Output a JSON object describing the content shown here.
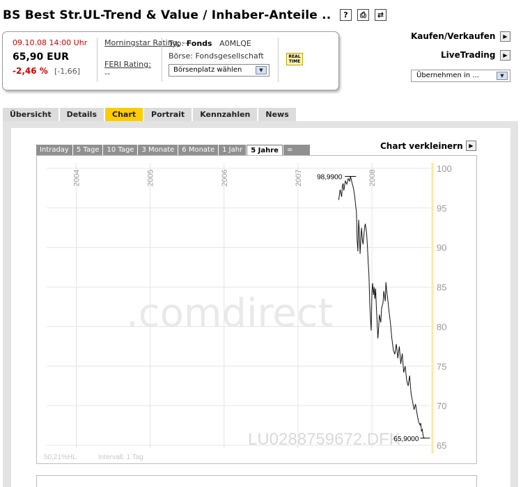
{
  "header": {
    "title": "BS Best Str.UL-Trend & Value / Inhaber-Anteile ..",
    "icons": [
      "help-icon",
      "print-icon",
      "share-icon"
    ]
  },
  "quote": {
    "datetime": "09.10.08 14:00 Uhr",
    "price": "65,90 EUR",
    "change_pct": "-2,46 %",
    "change_abs": "[-1,66]",
    "morningstar_label": "Morningstar Rating:",
    "morningstar_value": "--",
    "feri_label": "FERI Rating:",
    "feri_value": "--",
    "typ_label": "Typ:",
    "typ_value": "Fonds",
    "wkn": "A0MLQE",
    "boerse": "Börse: Fondsgesellschaft",
    "boersenplatz_select": "Börsenplatz wählen",
    "realtime_badge": "REAL TIME"
  },
  "side": {
    "kaufen": "Kaufen/Verkaufen",
    "livetrading": "LiveTrading",
    "uebernehmen": "Übernehmen in ..."
  },
  "tabs": [
    {
      "label": "Übersicht",
      "active": false
    },
    {
      "label": "Details",
      "active": false
    },
    {
      "label": "Chart",
      "active": true
    },
    {
      "label": "Portrait",
      "active": false
    },
    {
      "label": "Kennzahlen",
      "active": false
    },
    {
      "label": "News",
      "active": false
    }
  ],
  "periods": [
    {
      "label": "Intraday",
      "active": false
    },
    {
      "label": "5 Tage",
      "active": false
    },
    {
      "label": "10 Tage",
      "active": false
    },
    {
      "label": "3 Monate",
      "active": false
    },
    {
      "label": "6 Monate",
      "active": false
    },
    {
      "label": "1 Jahr",
      "active": false
    },
    {
      "label": "5 Jahre",
      "active": true
    },
    {
      "label": "∞",
      "active": false
    }
  ],
  "chart_toggle": "Chart verkleinern",
  "colors": {
    "accent": "#ffcc00",
    "negative": "#cc0000",
    "tab_bg": "#dcdcdc",
    "period_bg": "#909090",
    "watermark": "#e9e9e9",
    "marker": "#ffe7a0"
  },
  "chart_data": {
    "type": "line",
    "x_ticks": [
      "2004",
      "2005",
      "2006",
      "2007",
      "2008"
    ],
    "y_ticks": [
      100,
      95,
      90,
      85,
      80,
      75,
      70,
      65
    ],
    "ylim": [
      65,
      100
    ],
    "xlim": [
      2003.6,
      2008.8
    ],
    "max_label": "98,9900",
    "last_label": "65,9000",
    "watermark": ".comdirect",
    "isin_label": "LU0288759672.DFK",
    "footer_left": "50,21%HL",
    "footer_interval": "Intervall: 1 Tag",
    "series": [
      {
        "x": [
          2007.55,
          2007.57,
          2007.59,
          2007.6,
          2007.61,
          2007.62,
          2007.64,
          2007.66,
          2007.68,
          2007.7,
          2007.71,
          2007.72,
          2007.73,
          2007.75,
          2007.77,
          2007.78,
          2007.79,
          2007.8,
          2007.81,
          2007.82,
          2007.83,
          2007.84,
          2007.85,
          2007.86,
          2007.87,
          2007.88,
          2007.9,
          2007.91,
          2007.92,
          2007.93,
          2007.94,
          2007.95,
          2007.96,
          2007.97,
          2007.98,
          2007.99,
          2008.0,
          2008.01,
          2008.02,
          2008.03,
          2008.04,
          2008.05,
          2008.06,
          2008.07,
          2008.08,
          2008.09,
          2008.1,
          2008.12,
          2008.13,
          2008.15,
          2008.16,
          2008.18,
          2008.19,
          2008.2,
          2008.22,
          2008.23,
          2008.25,
          2008.27,
          2008.29,
          2008.31,
          2008.33,
          2008.35,
          2008.37,
          2008.39,
          2008.41,
          2008.43,
          2008.45,
          2008.47,
          2008.49,
          2008.51,
          2008.53,
          2008.55,
          2008.57,
          2008.59,
          2008.61,
          2008.63,
          2008.65,
          2008.66,
          2008.67,
          2008.68,
          2008.69,
          2008.7,
          2008.71
        ],
        "y": [
          96.0,
          97.3,
          96.4,
          97.8,
          98.1,
          97.2,
          98.4,
          98.0,
          98.7,
          98.4,
          98.99,
          98.6,
          98.2,
          97.5,
          96.2,
          95.3,
          94.5,
          91.0,
          89.5,
          93.5,
          92.0,
          89.2,
          91.2,
          92.5,
          91.0,
          90.4,
          92.5,
          93.0,
          92.4,
          91.6,
          90.0,
          88.0,
          86.5,
          83.0,
          81.0,
          79.5,
          84.5,
          85.5,
          84.0,
          85.0,
          83.5,
          84.8,
          82.5,
          80.6,
          78.5,
          79.7,
          81.5,
          80.5,
          82.3,
          83.0,
          84.5,
          83.2,
          85.6,
          84.5,
          83.0,
          82.0,
          80.5,
          78.5,
          77.0,
          76.5,
          77.8,
          76.0,
          77.5,
          75.3,
          76.6,
          74.2,
          75.0,
          73.2,
          72.5,
          73.8,
          71.5,
          70.5,
          69.5,
          70.2,
          69.0,
          68.0,
          67.56,
          67.8,
          66.8,
          67.0,
          66.4,
          65.95,
          65.9
        ]
      }
    ]
  }
}
